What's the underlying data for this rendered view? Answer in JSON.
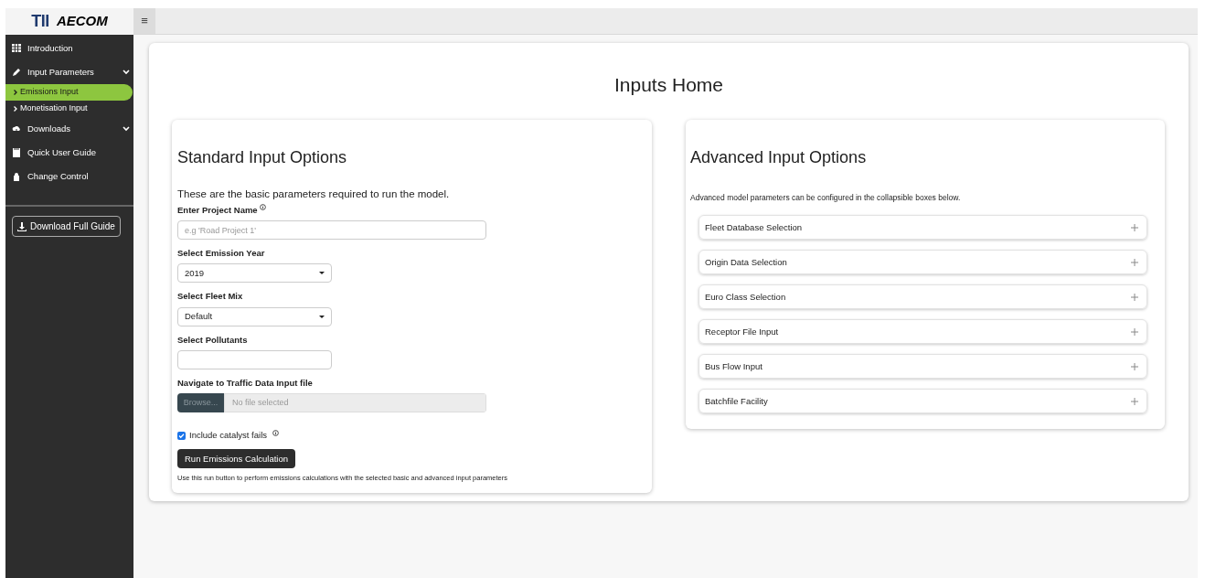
{
  "header": {
    "logo": [
      "TII",
      "AECOM"
    ],
    "menu_toggle": "≡"
  },
  "sidebar": {
    "items": [
      {
        "label": "Introduction"
      },
      {
        "label": "Input Parameters",
        "kind": "group",
        "children": [
          {
            "label": "Emissions Input",
            "selected": true
          },
          {
            "label": "Monetisation Input",
            "selected": false
          }
        ]
      },
      {
        "label": "Downloads",
        "kind": "group"
      },
      {
        "label": "Quick User Guide"
      },
      {
        "label": "Change Control"
      }
    ],
    "download_button": "Download Full Guide"
  },
  "page_title": "Inputs Home",
  "standard": {
    "title": "Standard Input Options",
    "intro": "These are the basic parameters required to run the model.",
    "fields": [
      {
        "kind": "text",
        "label": "Enter Project Name",
        "info": true,
        "placeholder": "e.g 'Road Project 1'"
      },
      {
        "kind": "select",
        "label": "Select Emission Year",
        "value": "2019"
      },
      {
        "kind": "select",
        "label": "Select Fleet Mix",
        "value": "Default"
      },
      {
        "kind": "multi",
        "label": "Select Pollutants"
      },
      {
        "kind": "file",
        "label": "Navigate to Traffic Data Input file",
        "button": "Browse...",
        "placeholder": "No file selected"
      }
    ],
    "checkbox": {
      "label": "Include catalyst fails",
      "checked": true,
      "info": true
    },
    "run_button": "Run Emissions Calculation",
    "note": "Use this run button to perform emissions calculations with the selected basic and advanced input parameters"
  },
  "advanced": {
    "title": "Advanced Input Options",
    "intro": "Advanced model parameters can be configured in the collapsible boxes below.",
    "boxes": [
      {
        "label": "Fleet Database Selection",
        "expanded": false
      },
      {
        "label": "Origin Data Selection",
        "expanded": false
      },
      {
        "label": "Euro Class Selection",
        "expanded": false
      },
      {
        "label": "Receptor File Input",
        "expanded": false
      },
      {
        "label": "Bus Flow Input",
        "expanded": false
      },
      {
        "label": "Batchfile Facility",
        "expanded": false
      }
    ]
  }
}
